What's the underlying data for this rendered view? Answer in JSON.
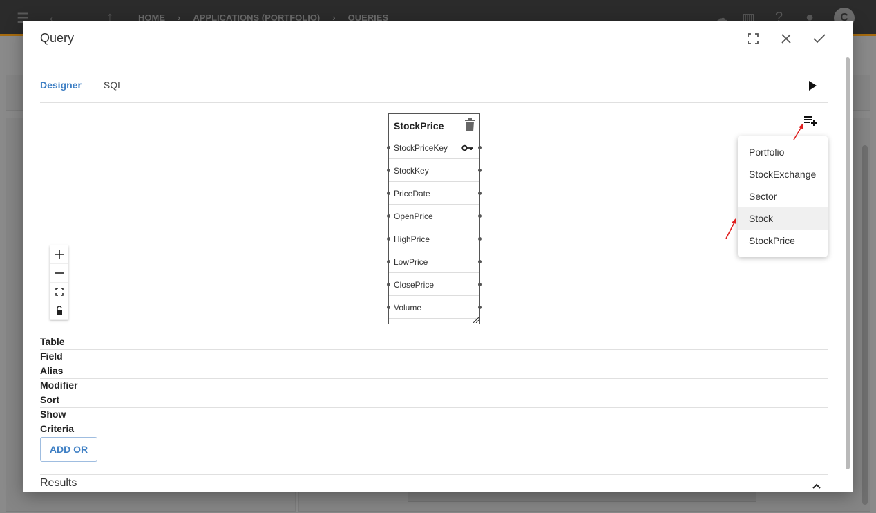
{
  "breadcrumb": {
    "home": "HOME",
    "applications": "APPLICATIONS (PORTFOLIO)",
    "queries": "QUERIES"
  },
  "user": {
    "avatar_letter": "C"
  },
  "dialog": {
    "title": "Query",
    "tabs": [
      {
        "label": "Designer",
        "active": true
      },
      {
        "label": "SQL",
        "active": false
      }
    ]
  },
  "table_box": {
    "name": "StockPrice",
    "fields": [
      "StockPriceKey",
      "StockKey",
      "PriceDate",
      "OpenPrice",
      "HighPrice",
      "LowPrice",
      "ClosePrice",
      "Volume"
    ],
    "primary_key_field": "StockPriceKey"
  },
  "add_table_menu": {
    "items": [
      "Portfolio",
      "StockExchange",
      "Sector",
      "Stock",
      "StockPrice"
    ],
    "hovered": "Stock"
  },
  "grid": {
    "rows": [
      "Table",
      "Field",
      "Alias",
      "Modifier",
      "Sort",
      "Show",
      "Criteria"
    ]
  },
  "add_or_label": "ADD OR",
  "results_label": "Results",
  "colors": {
    "accent": "#3e7fc4",
    "annotation_arrow": "#e02020"
  },
  "icons": {
    "header": [
      "fullscreen-icon",
      "close-icon",
      "check-icon"
    ],
    "zoom": [
      "plus-icon",
      "minus-icon",
      "fit-screen-icon",
      "lock-open-icon"
    ]
  }
}
